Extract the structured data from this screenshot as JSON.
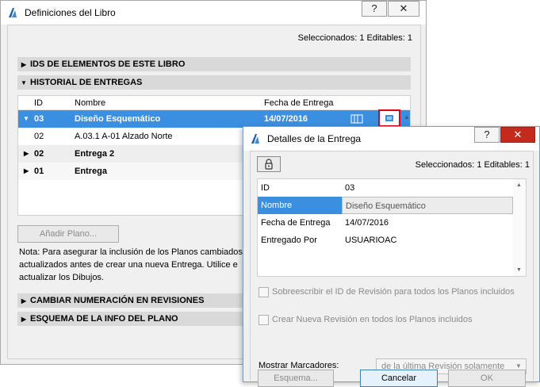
{
  "main": {
    "title": "Definiciones del Libro",
    "help_label": "?",
    "close_label": "✕",
    "selection_info": "Seleccionados: 1 Editables: 1",
    "sections": {
      "ids": "IDS DE ELEMENTOS DE ESTE LIBRO",
      "historial": "HISTORIAL DE ENTREGAS",
      "numeracion": "CAMBIAR NUMERACIÓN EN REVISIONES",
      "esquema": "ESQUEMA DE LA INFO DEL PLANO"
    },
    "columns": {
      "id": "ID",
      "nombre": "Nombre",
      "fecha": "Fecha de Entrega"
    },
    "rows": [
      {
        "id": "03",
        "nombre": "Diseño Esquemático",
        "fecha": "14/07/2016",
        "state": "selected",
        "expanded": true
      },
      {
        "id": "02",
        "nombre": "A.03.1 A-01 Alzado Norte",
        "fecha": "",
        "state": "child"
      },
      {
        "id": "02",
        "nombre": "Entrega 2",
        "fecha": "",
        "state": "group",
        "expanded": false
      },
      {
        "id": "01",
        "nombre": "Entrega",
        "fecha": "",
        "state": "group",
        "expanded": false
      }
    ],
    "add_button": "Añadir Plano...",
    "note_lines": [
      "Nota: Para asegurar la inclusión de los Planos cambiados",
      "actualizados antes de crear una nueva Entrega. Utilice e",
      "actualizar los Dibujos."
    ]
  },
  "dialog": {
    "title": "Detalles de la Entrega",
    "help_label": "?",
    "close_label": "✕",
    "selection_info": "Seleccionados: 1 Editables: 1",
    "fields": [
      {
        "key": "ID",
        "value": "03"
      },
      {
        "key": "Nombre",
        "value": "Diseño Esquemático"
      },
      {
        "key": "Fecha de Entrega",
        "value": "14/07/2016"
      },
      {
        "key": "Entregado Por",
        "value": "USUARIOAC"
      }
    ],
    "check_overwrite": "Sobreescribir el ID de Revisión para todos los Planos incluidos",
    "check_new_revision": "Crear Nueva Revisión en todos los Planos incluidos",
    "markers_label": "Mostrar Marcadores:",
    "markers_value": "de la última Revisión solamente",
    "buttons": {
      "schema": "Esquema...",
      "cancel": "Cancelar",
      "ok": "OK"
    }
  },
  "colors": {
    "selection": "#3b8fe0",
    "highlight_border": "#e3001b",
    "section_bg": "#d9d9d9"
  }
}
